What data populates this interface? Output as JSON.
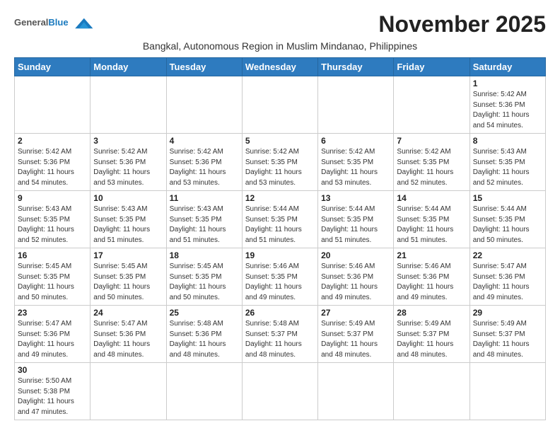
{
  "header": {
    "logo_general": "General",
    "logo_blue": "Blue",
    "month_title": "November 2025",
    "subtitle": "Bangkal, Autonomous Region in Muslim Mindanao, Philippines"
  },
  "days_of_week": [
    "Sunday",
    "Monday",
    "Tuesday",
    "Wednesday",
    "Thursday",
    "Friday",
    "Saturday"
  ],
  "weeks": [
    [
      {
        "day": "",
        "info": ""
      },
      {
        "day": "",
        "info": ""
      },
      {
        "day": "",
        "info": ""
      },
      {
        "day": "",
        "info": ""
      },
      {
        "day": "",
        "info": ""
      },
      {
        "day": "",
        "info": ""
      },
      {
        "day": "1",
        "info": "Sunrise: 5:42 AM\nSunset: 5:36 PM\nDaylight: 11 hours\nand 54 minutes."
      }
    ],
    [
      {
        "day": "2",
        "info": "Sunrise: 5:42 AM\nSunset: 5:36 PM\nDaylight: 11 hours\nand 54 minutes."
      },
      {
        "day": "3",
        "info": "Sunrise: 5:42 AM\nSunset: 5:36 PM\nDaylight: 11 hours\nand 53 minutes."
      },
      {
        "day": "4",
        "info": "Sunrise: 5:42 AM\nSunset: 5:36 PM\nDaylight: 11 hours\nand 53 minutes."
      },
      {
        "day": "5",
        "info": "Sunrise: 5:42 AM\nSunset: 5:35 PM\nDaylight: 11 hours\nand 53 minutes."
      },
      {
        "day": "6",
        "info": "Sunrise: 5:42 AM\nSunset: 5:35 PM\nDaylight: 11 hours\nand 53 minutes."
      },
      {
        "day": "7",
        "info": "Sunrise: 5:42 AM\nSunset: 5:35 PM\nDaylight: 11 hours\nand 52 minutes."
      },
      {
        "day": "8",
        "info": "Sunrise: 5:43 AM\nSunset: 5:35 PM\nDaylight: 11 hours\nand 52 minutes."
      }
    ],
    [
      {
        "day": "9",
        "info": "Sunrise: 5:43 AM\nSunset: 5:35 PM\nDaylight: 11 hours\nand 52 minutes."
      },
      {
        "day": "10",
        "info": "Sunrise: 5:43 AM\nSunset: 5:35 PM\nDaylight: 11 hours\nand 51 minutes."
      },
      {
        "day": "11",
        "info": "Sunrise: 5:43 AM\nSunset: 5:35 PM\nDaylight: 11 hours\nand 51 minutes."
      },
      {
        "day": "12",
        "info": "Sunrise: 5:44 AM\nSunset: 5:35 PM\nDaylight: 11 hours\nand 51 minutes."
      },
      {
        "day": "13",
        "info": "Sunrise: 5:44 AM\nSunset: 5:35 PM\nDaylight: 11 hours\nand 51 minutes."
      },
      {
        "day": "14",
        "info": "Sunrise: 5:44 AM\nSunset: 5:35 PM\nDaylight: 11 hours\nand 51 minutes."
      },
      {
        "day": "15",
        "info": "Sunrise: 5:44 AM\nSunset: 5:35 PM\nDaylight: 11 hours\nand 50 minutes."
      }
    ],
    [
      {
        "day": "16",
        "info": "Sunrise: 5:45 AM\nSunset: 5:35 PM\nDaylight: 11 hours\nand 50 minutes."
      },
      {
        "day": "17",
        "info": "Sunrise: 5:45 AM\nSunset: 5:35 PM\nDaylight: 11 hours\nand 50 minutes."
      },
      {
        "day": "18",
        "info": "Sunrise: 5:45 AM\nSunset: 5:35 PM\nDaylight: 11 hours\nand 50 minutes."
      },
      {
        "day": "19",
        "info": "Sunrise: 5:46 AM\nSunset: 5:35 PM\nDaylight: 11 hours\nand 49 minutes."
      },
      {
        "day": "20",
        "info": "Sunrise: 5:46 AM\nSunset: 5:36 PM\nDaylight: 11 hours\nand 49 minutes."
      },
      {
        "day": "21",
        "info": "Sunrise: 5:46 AM\nSunset: 5:36 PM\nDaylight: 11 hours\nand 49 minutes."
      },
      {
        "day": "22",
        "info": "Sunrise: 5:47 AM\nSunset: 5:36 PM\nDaylight: 11 hours\nand 49 minutes."
      }
    ],
    [
      {
        "day": "23",
        "info": "Sunrise: 5:47 AM\nSunset: 5:36 PM\nDaylight: 11 hours\nand 49 minutes."
      },
      {
        "day": "24",
        "info": "Sunrise: 5:47 AM\nSunset: 5:36 PM\nDaylight: 11 hours\nand 48 minutes."
      },
      {
        "day": "25",
        "info": "Sunrise: 5:48 AM\nSunset: 5:36 PM\nDaylight: 11 hours\nand 48 minutes."
      },
      {
        "day": "26",
        "info": "Sunrise: 5:48 AM\nSunset: 5:37 PM\nDaylight: 11 hours\nand 48 minutes."
      },
      {
        "day": "27",
        "info": "Sunrise: 5:49 AM\nSunset: 5:37 PM\nDaylight: 11 hours\nand 48 minutes."
      },
      {
        "day": "28",
        "info": "Sunrise: 5:49 AM\nSunset: 5:37 PM\nDaylight: 11 hours\nand 48 minutes."
      },
      {
        "day": "29",
        "info": "Sunrise: 5:49 AM\nSunset: 5:37 PM\nDaylight: 11 hours\nand 48 minutes."
      }
    ],
    [
      {
        "day": "30",
        "info": "Sunrise: 5:50 AM\nSunset: 5:38 PM\nDaylight: 11 hours\nand 47 minutes."
      },
      {
        "day": "",
        "info": ""
      },
      {
        "day": "",
        "info": ""
      },
      {
        "day": "",
        "info": ""
      },
      {
        "day": "",
        "info": ""
      },
      {
        "day": "",
        "info": ""
      },
      {
        "day": "",
        "info": ""
      }
    ]
  ]
}
